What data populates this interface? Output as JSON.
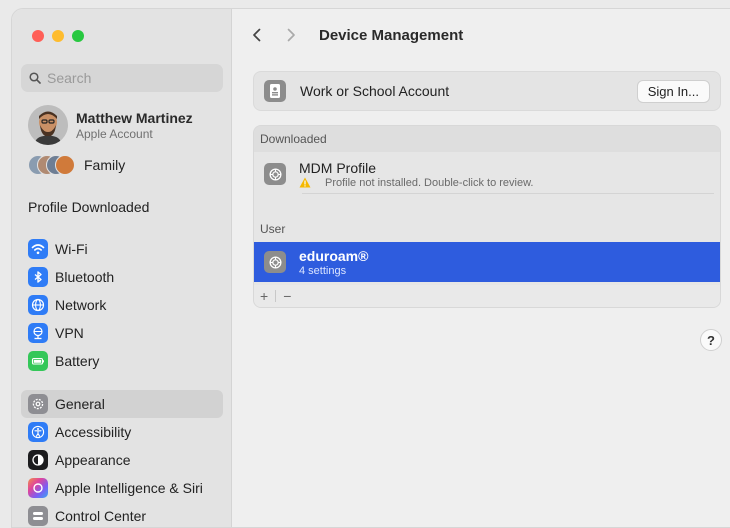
{
  "sidebar": {
    "search_placeholder": "Search",
    "account": {
      "name": "Matthew Martinez",
      "subtitle": "Apple Account"
    },
    "family_label": "Family",
    "profile_downloaded": "Profile Downloaded",
    "items": [
      {
        "label": "Wi-Fi",
        "icon": "wifi-icon",
        "color": "#2f7cf6"
      },
      {
        "label": "Bluetooth",
        "icon": "bluetooth-icon",
        "color": "#2f7cf6"
      },
      {
        "label": "Network",
        "icon": "globe-icon",
        "color": "#2f7cf6"
      },
      {
        "label": "VPN",
        "icon": "vpn-icon",
        "color": "#2f7cf6"
      },
      {
        "label": "Battery",
        "icon": "battery-icon",
        "color": "#34c759"
      },
      {
        "label": "General",
        "icon": "gear-icon",
        "color": "#8e8e93"
      },
      {
        "label": "Accessibility",
        "icon": "accessibility-icon",
        "color": "#2f7cf6"
      },
      {
        "label": "Appearance",
        "icon": "appearance-icon",
        "color": "#1c1c1e"
      },
      {
        "label": "Apple Intelligence & Siri",
        "icon": "siri-icon",
        "color": "#a05cf0"
      },
      {
        "label": "Control Center",
        "icon": "control-center-icon",
        "color": "#8e8e93"
      }
    ],
    "active_item": "General"
  },
  "main": {
    "title": "Device Management",
    "work_school": {
      "label": "Work or School Account",
      "button": "Sign In..."
    },
    "downloaded_header": "Downloaded",
    "mdm": {
      "title": "MDM Profile",
      "status": "Profile not installed. Double-click to review."
    },
    "user_header": "User",
    "eduroam": {
      "title": "eduroam®",
      "subtitle": "4 settings"
    },
    "footer": {
      "add": "+",
      "remove": "−"
    },
    "help": "?"
  },
  "colors": {
    "accent": "#2e5cde",
    "warning": "#f5b800"
  }
}
